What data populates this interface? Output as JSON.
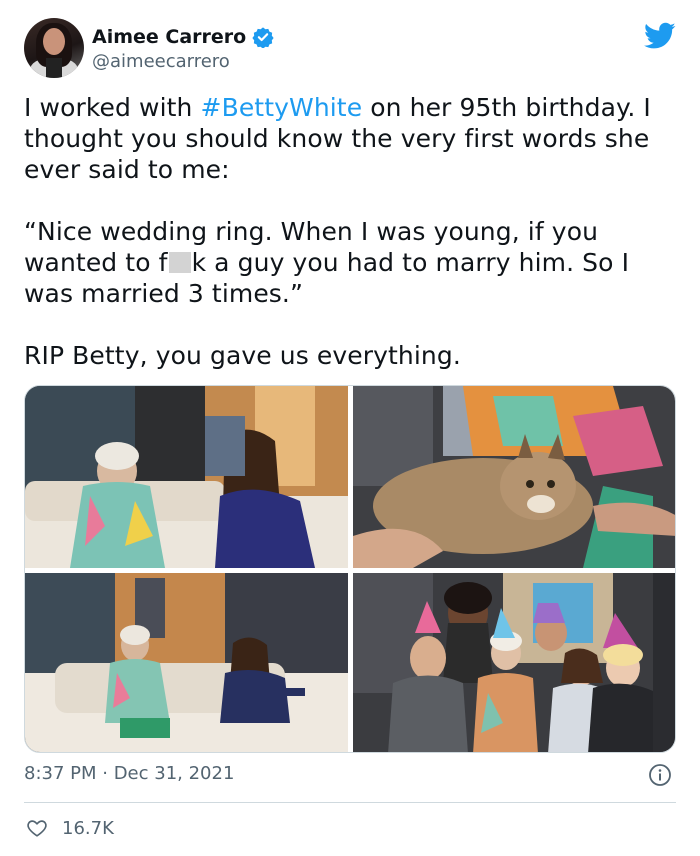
{
  "author": {
    "display_name": "Aimee Carrero",
    "handle": "@aimeecarrero",
    "verified": true
  },
  "tweet": {
    "line1_before": "I worked with ",
    "hashtag": "#BettyWhite",
    "line1_after": " on her 95th birthday. I thought you should know the very first words she ever said to me:",
    "quote_before": "“Nice wedding ring. When I was young, if you wanted to f",
    "quote_after": "k a guy you had to marry him. So I was married 3 times.”",
    "closing": "RIP Betty, you gave us everything."
  },
  "media": {
    "photos": [
      {
        "icon": "photo-set-couch-conversation"
      },
      {
        "icon": "photo-lynx-on-set"
      },
      {
        "icon": "photo-set-couch-wide"
      },
      {
        "icon": "photo-party-hats-group"
      }
    ]
  },
  "timestamp": "8:37 PM · Dec 31, 2021",
  "likes": "16.7K",
  "colors": {
    "accent": "#1d9bf0",
    "text": "#0f1419",
    "secondary": "#536471",
    "border": "#cfd9de"
  }
}
